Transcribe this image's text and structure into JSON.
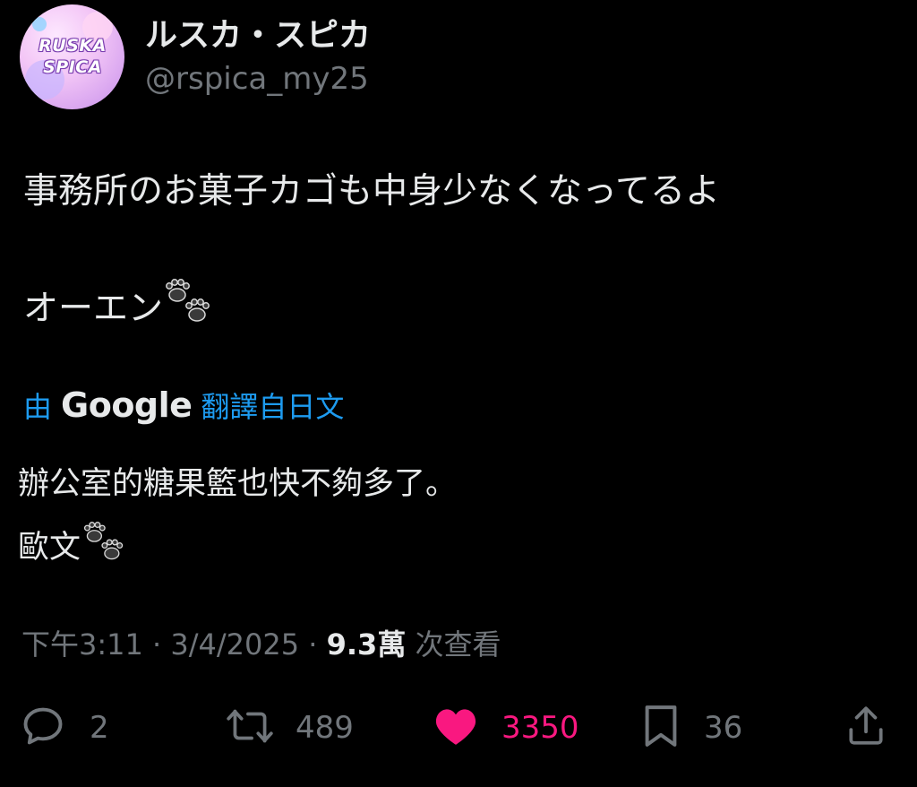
{
  "author": {
    "display_name": "ルスカ・スピカ",
    "handle": "@rspica_my25",
    "avatar_logo_line1": "RUSKA",
    "avatar_logo_line2": "SPICA"
  },
  "tweet": {
    "line1": "事務所のお菓子カゴも中身少なくなってるよ",
    "line2": "オーエン",
    "emoji": "paw-prints-icon"
  },
  "translation": {
    "prefix": "由",
    "brand": "Google",
    "link": "翻譯自日文",
    "line1": "辦公室的糖果籃也快不夠多了。",
    "line2": "歐文"
  },
  "meta": {
    "time": "下午3:11",
    "sep1": " · ",
    "date": "3/4/2025",
    "sep2": " · ",
    "views_count": "9.3萬",
    "views_label": " 次查看"
  },
  "actions": {
    "reply_count": "2",
    "retweet_count": "489",
    "like_count": "3350",
    "bookmark_count": "36"
  },
  "colors": {
    "background": "#000000",
    "text": "#e7e9ea",
    "secondary": "#71767b",
    "link": "#1d9bf0",
    "like": "#f91880"
  }
}
